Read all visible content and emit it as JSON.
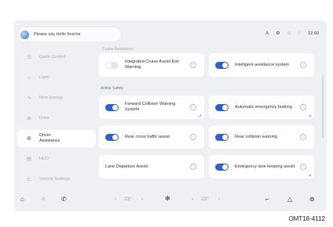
{
  "voice_assistant": {
    "prompt": "Please say Hello fourms"
  },
  "status_bar": {
    "icons": [
      "a-icon",
      "settings-icon",
      "wifi-icon",
      "bluetooth-icon"
    ],
    "time": "12:00"
  },
  "sidebar": {
    "items": [
      {
        "label": "Quick Control",
        "icon": "quick-control-icon",
        "active": false
      },
      {
        "label": "Light",
        "icon": "light-icon",
        "active": false
      },
      {
        "label": "New Energy",
        "icon": "new-energy-icon",
        "active": false
      },
      {
        "label": "Drive",
        "icon": "drive-icon",
        "active": false
      },
      {
        "label": "Driver Assistance",
        "icon": "driver-assistance-icon",
        "active": true
      },
      {
        "label": "HUD",
        "icon": "hud-icon",
        "active": false
      },
      {
        "label": "Vehicle Settings",
        "icon": "vehicle-settings-icon",
        "active": false
      }
    ]
  },
  "content": {
    "section_top": "Cruise Assistance",
    "section_active_safety": "Active Safety",
    "cards": [
      {
        "label": "Integrated Cruise Assist Exit Warning",
        "state": "off"
      },
      {
        "label": "Intelligent avoidance system",
        "state": "on"
      },
      {
        "label": "Forward Collision Warning System",
        "state": "on"
      },
      {
        "label": "Automatic emergency braking",
        "state": "on"
      },
      {
        "label": "Rear cross traffic assist",
        "state": "on"
      },
      {
        "label": "Rear collision warning",
        "state": "on"
      },
      {
        "label": "Lane Departure Assist",
        "state": "none"
      },
      {
        "label": "Emergency lane keeping assist",
        "state": "on"
      }
    ]
  },
  "dock": {
    "left_temp": "23°",
    "right_temp": "23°",
    "left_arrow": "‹",
    "right_arrow": "›"
  },
  "caption": "OMT18-4112",
  "colors": {
    "accent": "#2f5fd8",
    "background": "#eef0f3",
    "card": "#ffffff"
  }
}
